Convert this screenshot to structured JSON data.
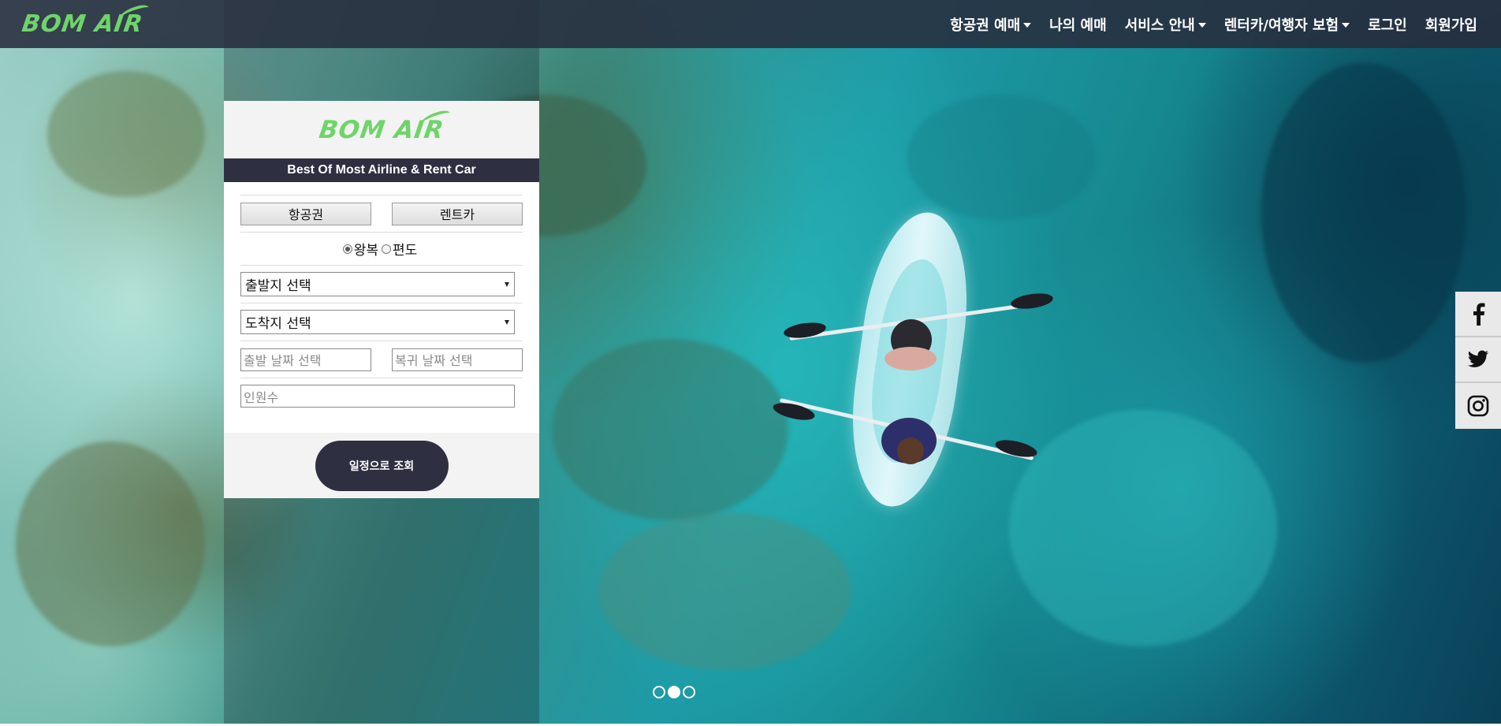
{
  "brand": {
    "logo_text": "BOM AIR",
    "logo_color": "#6fd46a",
    "navy": "#2e3042"
  },
  "nav": {
    "items": [
      {
        "label": "항공권 예매",
        "dropdown": true
      },
      {
        "label": "나의 예매",
        "dropdown": false
      },
      {
        "label": "서비스 안내",
        "dropdown": true
      },
      {
        "label": "렌터카/여행자 보험",
        "dropdown": true
      },
      {
        "label": "로그인",
        "dropdown": false
      },
      {
        "label": "회원가입",
        "dropdown": false
      }
    ]
  },
  "panel": {
    "logo_text": "BOM AIR",
    "tagline": "Best Of Most Airline & Rent Car",
    "tabs": [
      "항공권",
      "렌트카"
    ],
    "trip_types": [
      {
        "label": "왕복",
        "selected": true
      },
      {
        "label": "편도",
        "selected": false
      }
    ],
    "departure_select": "출발지 선택",
    "arrival_select": "도착지 선택",
    "depart_date_placeholder": "출발 날짜 선택",
    "return_date_placeholder": "복귀 날짜 선택",
    "passengers_placeholder": "인원수",
    "search_button": "일정으로 조회"
  },
  "slider": {
    "total": 3,
    "active_index": 1
  },
  "social": [
    "facebook-icon",
    "twitter-icon",
    "instagram-icon"
  ]
}
